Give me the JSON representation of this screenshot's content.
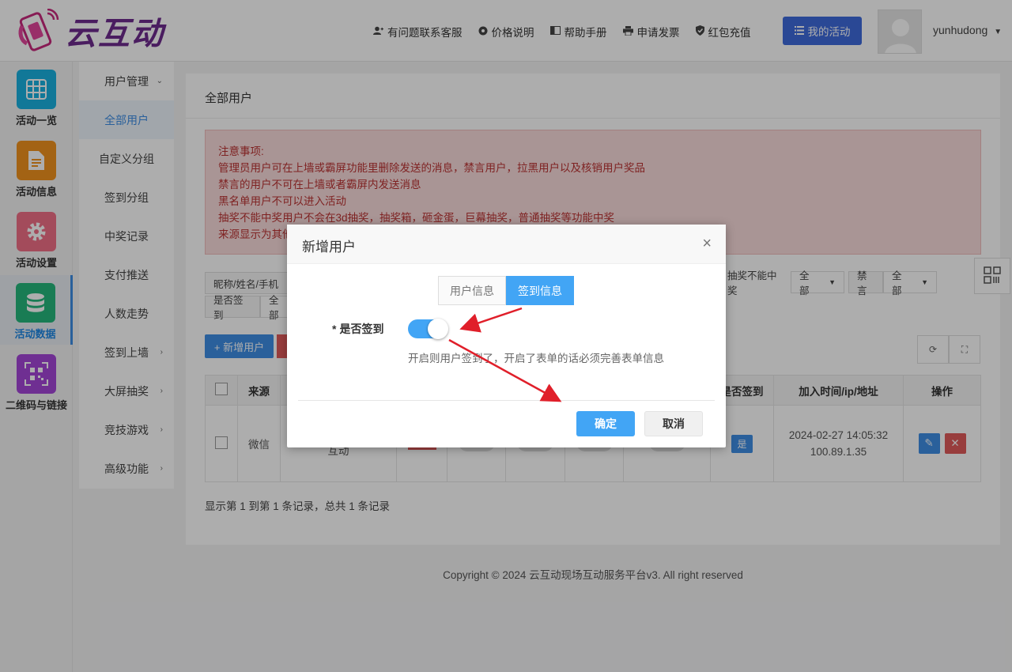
{
  "logo": {
    "text": "云互动"
  },
  "nav": [
    {
      "icon": "user-plus-icon",
      "glyph": "👤",
      "label": "有问题联系客服"
    },
    {
      "icon": "gear-icon",
      "glyph": "⚙",
      "label": "价格说明"
    },
    {
      "icon": "book-icon",
      "glyph": "▮",
      "label": "帮助手册"
    },
    {
      "icon": "printer-icon",
      "glyph": "▪",
      "label": "申请发票"
    },
    {
      "icon": "shield-check-icon",
      "glyph": "✔",
      "label": "红包充值"
    }
  ],
  "my_activity": {
    "label": "我的活动"
  },
  "user": {
    "name": "yunhudong"
  },
  "iconbar": [
    {
      "label": "活动一览",
      "color": "#1ab2e0",
      "icon": "grid-icon"
    },
    {
      "label": "活动信息",
      "color": "#f0921e",
      "icon": "document-icon"
    },
    {
      "label": "活动设置",
      "color": "#f06f87",
      "icon": "gear-icon"
    },
    {
      "label": "活动数据",
      "color": "#26b77c",
      "icon": "database-icon"
    },
    {
      "label": "二维码与链接",
      "color": "#a446d8",
      "icon": "qrcode-icon"
    }
  ],
  "submenu": [
    {
      "label": "用户管理",
      "arrow": "⌄"
    },
    {
      "label": "全部用户",
      "arrow": ""
    },
    {
      "label": "自定义分组",
      "arrow": ""
    },
    {
      "label": "签到分组",
      "arrow": ""
    },
    {
      "label": "中奖记录",
      "arrow": ""
    },
    {
      "label": "支付推送",
      "arrow": ""
    },
    {
      "label": "人数走势",
      "arrow": ""
    },
    {
      "label": "签到上墙",
      "arrow": "›"
    },
    {
      "label": "大屏抽奖",
      "arrow": "›"
    },
    {
      "label": "竞技游戏",
      "arrow": "›"
    },
    {
      "label": "高级功能",
      "arrow": "›"
    }
  ],
  "page": {
    "title": "全部用户"
  },
  "notice": {
    "lines": [
      "注意事项:",
      "管理员用户可在上墙或霸屏功能里删除发送的消息，禁言用户，拉黑用户以及核销用户奖品",
      "禁言的用户不可在上墙或者霸屏内发送消息",
      "黑名单用户不可以进入活动",
      "抽奖不能中奖用户不会在3d抽奖，抽奖箱，砸金蛋，巨幕抽奖，普通抽奖等功能中奖",
      "来源显示为其他"
    ]
  },
  "filters": {
    "search_label": "昵称/姓名/手机",
    "no_win_label": "抽奖不能中奖",
    "no_win_value": "全部",
    "mute_label": "禁言",
    "mute_value": "全部",
    "signed_label": "是否签到",
    "signed_value": "全部"
  },
  "toolbar": {
    "add_label": "+ 新增用户"
  },
  "table": {
    "headers": {
      "source": "来源",
      "signed": "是否签到",
      "joined": "加入时间/ip/地址",
      "ops": "操作"
    },
    "row": {
      "source": "微信",
      "name": "张帅 | 云图网络 | 云互动",
      "signed": "是",
      "time": "2024-02-27 14:05:32",
      "ip": "100.89.1.35"
    }
  },
  "summary": "显示第 1 到第 1 条记录，总共 1 条记录",
  "copyright": "Copyright © 2024 云互动现场互动服务平台v3. All right reserved",
  "modal": {
    "title": "新增用户",
    "close": "×",
    "tabs": [
      {
        "label": "用户信息",
        "active": false
      },
      {
        "label": "签到信息",
        "active": true
      }
    ],
    "field_label": "是否签到",
    "required_mark": "*",
    "switch_on": true,
    "help": "开启则用户签到了，开启了表单的话必须完善表单信息",
    "ok": "确定",
    "cancel": "取消"
  }
}
